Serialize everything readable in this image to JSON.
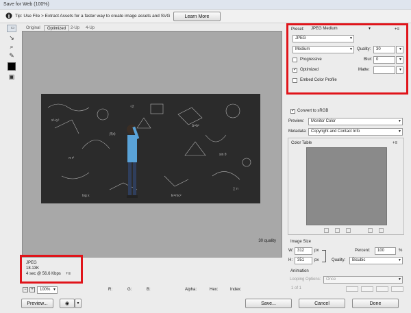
{
  "window": {
    "title": "Save for Web (100%)"
  },
  "tip": {
    "text": "Tip: Use File > Extract Assets for a faster way to create image assets and SVG",
    "button": "Learn More"
  },
  "tabs": [
    "Original",
    "Optimized",
    "2-Up",
    "4-Up"
  ],
  "info": {
    "format": "JPEG",
    "size": "18.13K",
    "time": "4 sec @ 56.6 Kbps",
    "menu": "+≡",
    "quality": "30 quality"
  },
  "settings": {
    "preset_label": "Preset:",
    "preset_value": "JPEG Medium",
    "menu": "+≡",
    "format": "JPEG",
    "quality_level": "Medium",
    "quality_label": "Quality:",
    "quality_value": "30",
    "progressive": "Progressive",
    "blur_label": "Blur:",
    "blur_value": "0",
    "optimized": "Optimized",
    "matte_label": "Matte:",
    "embed": "Embed Color Profile",
    "convert": "Convert to sRGB",
    "preview_label": "Preview:",
    "preview_value": "Monitor Color",
    "metadata_label": "Metadata:",
    "metadata_value": "Copyright and Contact Info"
  },
  "color_table": {
    "title": "Color Table",
    "menu": "+≡"
  },
  "image_size": {
    "title": "Image Size",
    "w_label": "W:",
    "w_value": "312",
    "h_label": "H:",
    "h_value": "351",
    "unit": "px",
    "percent_label": "Percent:",
    "percent_value": "100",
    "percent_unit": "%",
    "quality_label": "Quality:",
    "quality_value": "Bicubic"
  },
  "animation": {
    "title": "Animation",
    "looping_label": "Looping Options:",
    "looping_value": "Once",
    "frame": "1 of 1"
  },
  "status": {
    "zoom": "100%",
    "r": "R:",
    "g": "G:",
    "b": "B:",
    "alpha": "Alpha:",
    "hex": "Hex:",
    "index": "Index:"
  },
  "buttons": {
    "preview": "Preview...",
    "save": "Save...",
    "cancel": "Cancel",
    "done": "Done"
  },
  "colors": {
    "highlight": "#e0141a",
    "canvas": "#a8a8a8",
    "color_table": "#8a8a8a"
  }
}
